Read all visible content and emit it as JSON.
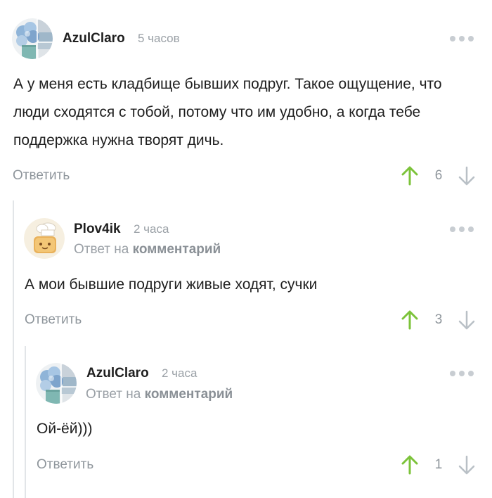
{
  "comments": [
    {
      "author": "AzulClaro",
      "time": "5 часов",
      "text": "А у меня есть кладбище бывших подруг. Такое ощущение, что люди сходятся с тобой, потому что им удобно, а когда тебе поддержка нужна творят дичь.",
      "reply_label": "Ответить",
      "score": "6",
      "avatar": "hydrangea-avatar"
    },
    {
      "author": "Plov4ik",
      "time": "2 часа",
      "reply_to_prefix": "Ответ на",
      "reply_to_link": "комментарий",
      "text": "А мои бывшие подруги живые ходят, сучки",
      "reply_label": "Ответить",
      "score": "3",
      "avatar": "chef-toast-avatar"
    },
    {
      "author": "AzulClaro",
      "time": "2 часа",
      "reply_to_prefix": "Ответ на",
      "reply_to_link": "комментарий",
      "text": "Ой-ёй)))",
      "reply_label": "Ответить",
      "score": "1",
      "avatar": "hydrangea-avatar"
    }
  ],
  "colors": {
    "upvote": "#7cc33a",
    "downvote": "#b9c0c6",
    "muted": "#9aa0a6",
    "thread_line": "#e2e5e8"
  }
}
